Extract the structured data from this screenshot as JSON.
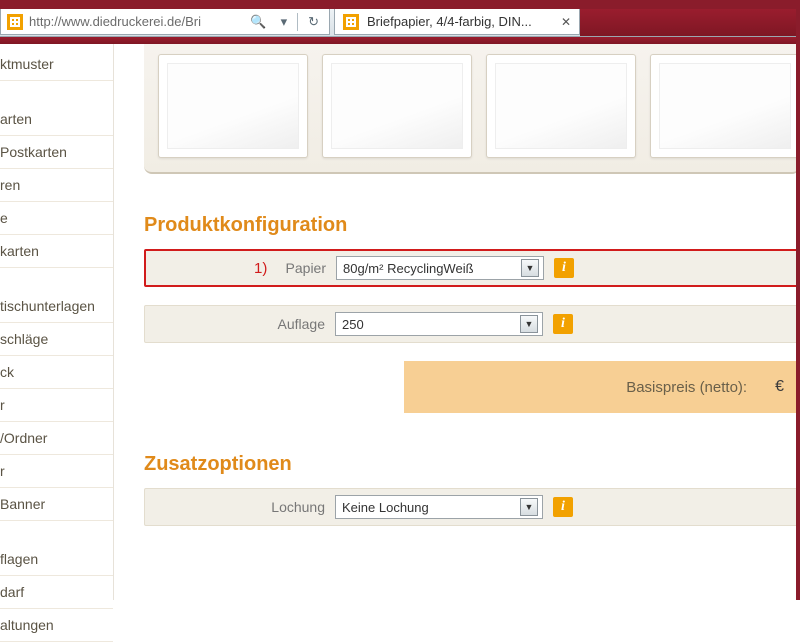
{
  "browser": {
    "url": "http://www.diedruckerei.de/Bri",
    "tab_title": "Briefpapier, 4/4-farbig, DIN..."
  },
  "sidebar": {
    "items": [
      "ktmuster",
      "",
      "arten",
      "Postkarten",
      "ren",
      "e",
      "karten",
      "",
      "tischunterlagen",
      "schläge",
      "ck",
      "r",
      "/Ordner",
      "r",
      "Banner",
      "",
      "flagen",
      "darf",
      "altungen"
    ]
  },
  "sections": {
    "config_title": "Produktkonfiguration",
    "extras_title": "Zusatzoptionen"
  },
  "rows": {
    "papier": {
      "label": "Papier",
      "value": "80g/m² RecyclingWeiß",
      "annot": "1)"
    },
    "auflage": {
      "label": "Auflage",
      "value": "250"
    },
    "lochung": {
      "label": "Lochung",
      "value": "Keine Lochung"
    }
  },
  "price": {
    "label": "Basispreis (netto):",
    "currency": "€"
  }
}
